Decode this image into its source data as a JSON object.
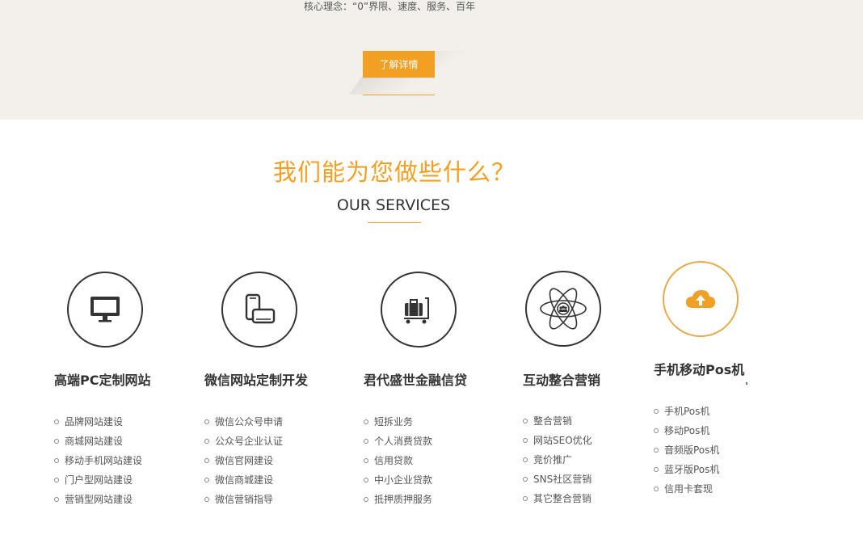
{
  "top": {
    "core_text": "核心理念：“0”界限、速度、服务、百年",
    "detail_button": "了解详情"
  },
  "section": {
    "title": "我们能为您做些什么？",
    "subtitle": "OUR SERVICES"
  },
  "services": [
    {
      "icon": "monitor-icon",
      "title": "高端PC定制网站",
      "items": [
        "品牌网站建设",
        "商城网站建设",
        "移动手机网站建设",
        "门户型网站建设",
        "营销型网站建设"
      ]
    },
    {
      "icon": "mobile-devices-icon",
      "title": "微信网站定制开发",
      "items": [
        "微信公众号申请",
        "公众号企业认证",
        "微信官网建设",
        "微信商城建设",
        "微信营销指导"
      ]
    },
    {
      "icon": "luggage-cart-icon",
      "title": "君代盛世金融信贷",
      "items": [
        "短拆业务",
        "个人消费贷款",
        "信用贷款",
        "中小企业贷款",
        "抵押质押服务"
      ]
    },
    {
      "icon": "atom-network-icon",
      "title": "互动整合营销",
      "items": [
        "整合营销",
        "网站SEO优化",
        "竞价推广",
        "SNS社区营销",
        "其它整合营销"
      ]
    },
    {
      "icon": "cloud-upload-icon",
      "title": "手机移动Pos机",
      "items": [
        "手机Pos机",
        "移动Pos机",
        "音频版Pos机",
        "蓝牙版Pos机",
        "信用卡套现"
      ]
    }
  ],
  "colors": {
    "accent": "#f2a023",
    "active_ring": "#e8aa47",
    "top_band": "#f3f0eb"
  }
}
